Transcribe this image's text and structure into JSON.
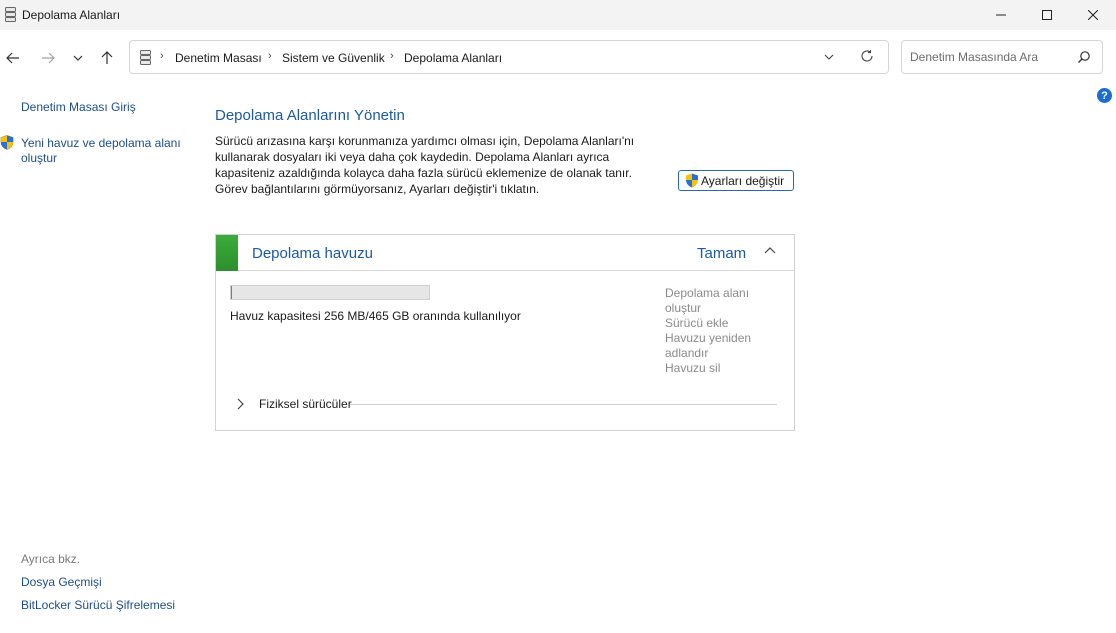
{
  "window": {
    "title": "Depolama Alanları"
  },
  "address": {
    "crumbs": [
      "Denetim Masası",
      "Sistem ve Güvenlik",
      "Depolama Alanları"
    ],
    "search_placeholder": "Denetim Masasında Ara"
  },
  "sidebar": {
    "home": "Denetim Masası Giriş",
    "new_pool": "Yeni havuz ve depolama alanı oluştur",
    "see_also": "Ayrıca bkz.",
    "file_history": "Dosya Geçmişi",
    "bitlocker": "BitLocker Sürücü Şifrelemesi"
  },
  "help": {
    "label": "?"
  },
  "main": {
    "title": "Depolama Alanlarını Yönetin",
    "description": "Sürücü arızasına karşı korunmanıza yardımcı olması için, Depolama Alanları'nı kullanarak dosyaları iki veya daha çok kaydedin. Depolama Alanları ayrıca kapasiteniz azaldığında kolayca daha fazla sürücü eklemenize de olanak tanır. Görev bağlantılarını görmüyorsanız, Ayarları değiştir'i tıklatın.",
    "settings_button": "Ayarları değiştir"
  },
  "pool": {
    "name": "Depolama havuzu",
    "status": "Tamam",
    "usage_text": "Havuz kapasitesi 256 MB/465 GB oranında kullanılıyor",
    "usage_fraction": 0.0005,
    "status_color": "#3cab3c",
    "actions": [
      "Depolama alanı oluştur",
      "Sürücü ekle",
      "Havuzu yeniden adlandır",
      "Havuzu sil"
    ],
    "physical_drives": "Fiziksel sürücüler"
  }
}
